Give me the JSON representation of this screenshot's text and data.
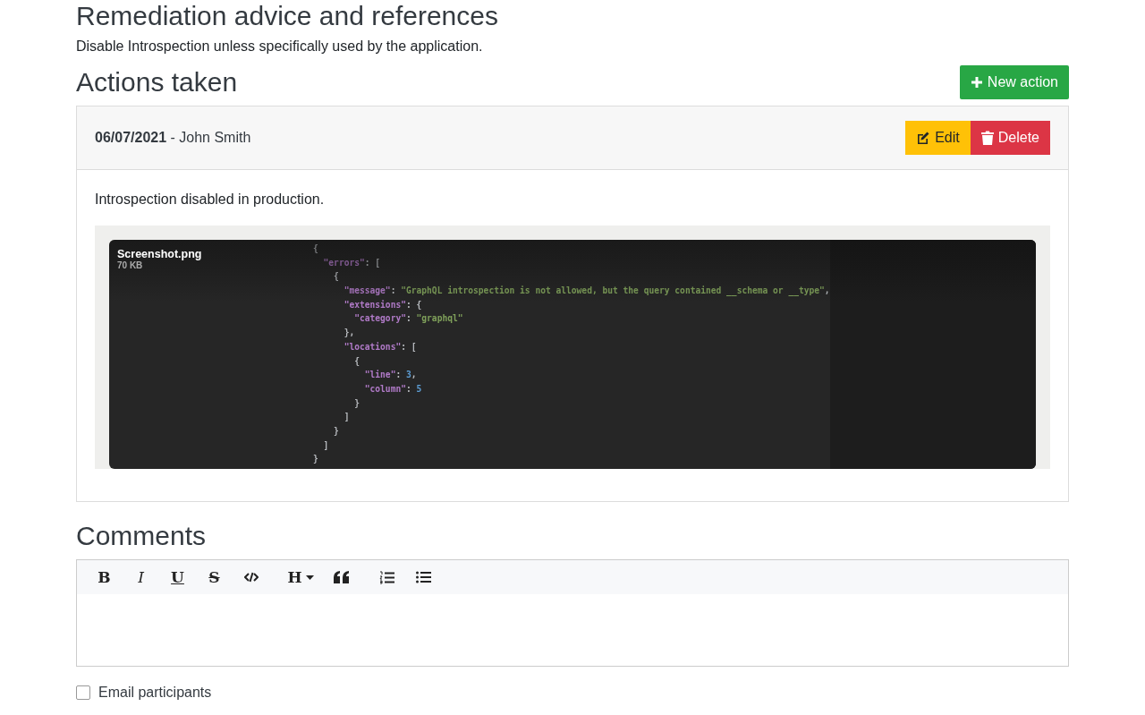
{
  "remediation": {
    "title": "Remediation advice and references",
    "text": "Disable Introspection unless specifically used by the application."
  },
  "actions": {
    "title": "Actions taken",
    "new_button": "New action",
    "items": [
      {
        "date": "06/07/2021",
        "author": "- John Smith",
        "edit_label": "Edit",
        "delete_label": "Delete",
        "text": "Introspection disabled in production.",
        "attachment": {
          "filename": "Screenshot.png",
          "size": "70 KB",
          "code_lines": [
            "{",
            "  \"errors\": [",
            "    {",
            "      \"message\": \"GraphQL introspection is not allowed, but the query contained __schema or __type\",",
            "      \"extensions\": {",
            "        \"category\": \"graphql\"",
            "      },",
            "      \"locations\": [",
            "        {",
            "          \"line\": 3,",
            "          \"column\": 5",
            "        }",
            "      ]",
            "    }",
            "  ]",
            "}"
          ]
        }
      }
    ]
  },
  "comments": {
    "title": "Comments",
    "toolbar": [
      {
        "kind": "bold",
        "label": "B"
      },
      {
        "kind": "italic",
        "label": "I"
      },
      {
        "kind": "underline",
        "label": "U"
      },
      {
        "kind": "strike",
        "label": "S"
      },
      {
        "kind": "code"
      },
      {
        "kind": "heading",
        "label": "H"
      },
      {
        "kind": "quote"
      },
      {
        "kind": "ordered-list"
      },
      {
        "kind": "bullet-list"
      }
    ],
    "email_participants": {
      "label": "Email participants",
      "checked": false
    }
  }
}
